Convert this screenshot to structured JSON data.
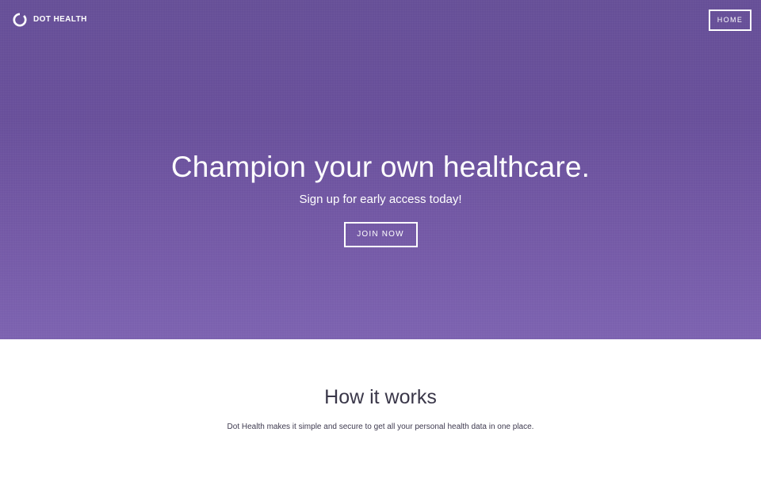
{
  "header": {
    "brand_name": "DOT HEALTH",
    "brand_icon": "ring-logo-icon",
    "home_label": "HOME"
  },
  "hero": {
    "title": "Champion your own healthcare.",
    "subtitle": "Sign up for early access today!",
    "cta_label": "JOIN NOW"
  },
  "how_it_works": {
    "title": "How it works",
    "description": "Dot Health makes it simple and secure to get all your personal health data in one place."
  },
  "colors": {
    "hero_top": "#664f97",
    "hero_bottom": "#7c62b0",
    "text_on_hero": "#ffffff",
    "section_text": "#3f3b50"
  }
}
